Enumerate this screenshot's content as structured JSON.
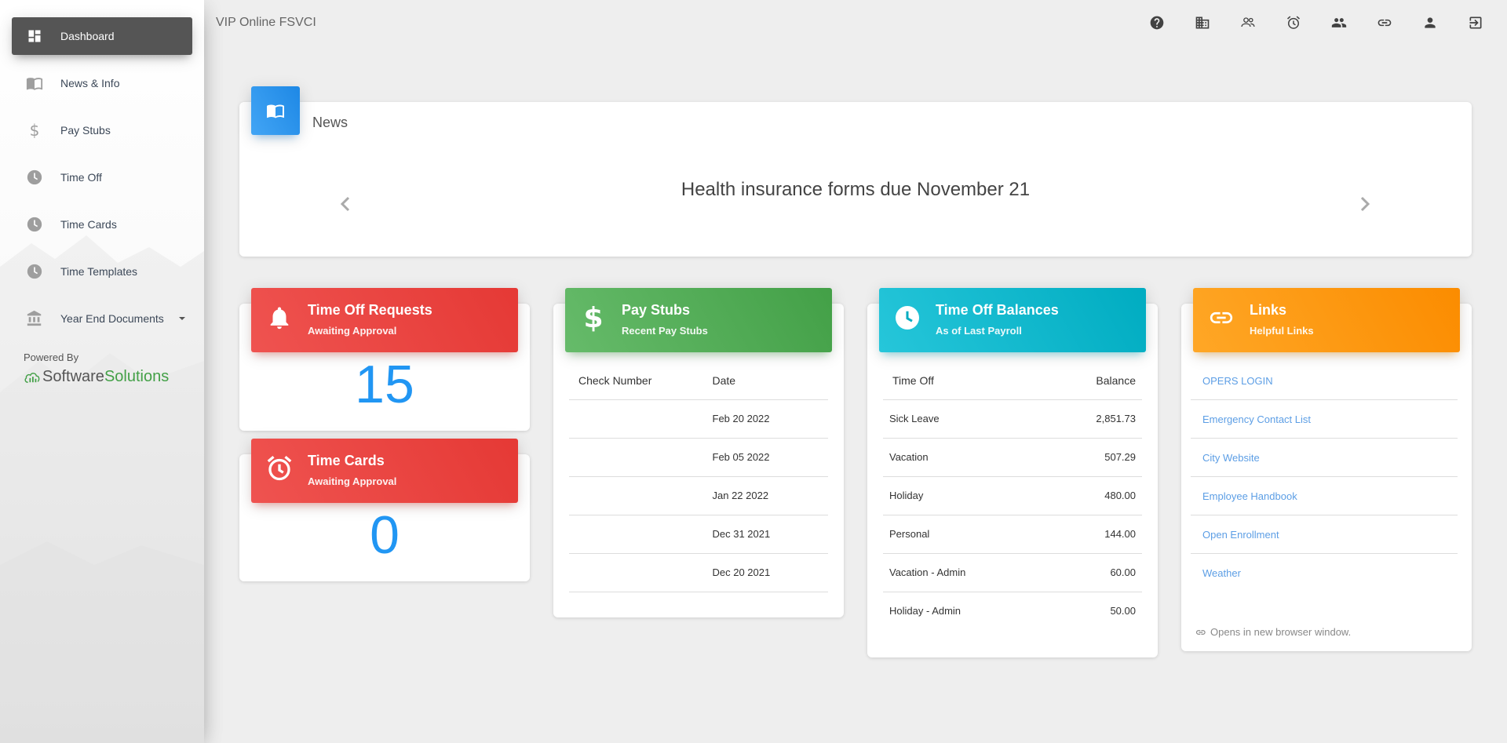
{
  "app": {
    "title": "VIP Online FSVCI"
  },
  "sidebar": {
    "items": [
      {
        "label": "Dashboard",
        "icon": "dashboard-icon",
        "active": true
      },
      {
        "label": "News & Info",
        "icon": "book-open-icon"
      },
      {
        "label": "Pay Stubs",
        "icon": "dollar-icon"
      },
      {
        "label": "Time Off",
        "icon": "clock-icon"
      },
      {
        "label": "Time Cards",
        "icon": "clock-icon"
      },
      {
        "label": "Time Templates",
        "icon": "clock-icon"
      },
      {
        "label": "Year End Documents",
        "icon": "bank-icon"
      }
    ],
    "powered_by": "Powered By",
    "brand": {
      "part1": "Software",
      "part2": "Solutions"
    }
  },
  "topbar": {
    "icons": [
      "help-icon",
      "building-icon",
      "group-outline-icon",
      "alarm-icon",
      "people-icon",
      "link-icon",
      "person-icon",
      "logout-icon"
    ]
  },
  "news": {
    "title": "News",
    "headline": "Health insurance forms due November 21"
  },
  "time_off_requests": {
    "title": "Time Off Requests",
    "subtitle": "Awaiting Approval",
    "count": "15"
  },
  "time_cards": {
    "title": "Time Cards",
    "subtitle": "Awaiting Approval",
    "count": "0"
  },
  "pay_stubs": {
    "title": "Pay Stubs",
    "subtitle": "Recent Pay Stubs",
    "columns": [
      "Check Number",
      "Date"
    ],
    "rows": [
      {
        "check": "",
        "date": "Feb 20 2022"
      },
      {
        "check": "",
        "date": "Feb 05 2022"
      },
      {
        "check": "",
        "date": "Jan 22 2022"
      },
      {
        "check": "",
        "date": "Dec 31 2021"
      },
      {
        "check": "",
        "date": "Dec 20 2021"
      }
    ]
  },
  "balances": {
    "title": "Time Off Balances",
    "subtitle": "As of Last Payroll",
    "columns": [
      "Time Off",
      "Balance"
    ],
    "rows": [
      {
        "name": "Sick Leave",
        "value": "2,851.73"
      },
      {
        "name": "Vacation",
        "value": "507.29"
      },
      {
        "name": "Holiday",
        "value": "480.00"
      },
      {
        "name": "Personal",
        "value": "144.00"
      },
      {
        "name": "Vacation - Admin",
        "value": "60.00"
      },
      {
        "name": "Holiday - Admin",
        "value": "50.00"
      }
    ]
  },
  "links": {
    "title": "Links",
    "subtitle": "Helpful Links",
    "items": [
      "OPERS LOGIN",
      "Emergency Contact List",
      "City Website",
      "Employee Handbook",
      "Open Enrollment",
      "Weather"
    ],
    "footer": "Opens in new browser window."
  },
  "colors": {
    "accent_blue": "#2196f3",
    "link_blue": "#5c9ee5",
    "red": "#e53935",
    "green": "#43a047",
    "cyan": "#00acc1",
    "orange": "#fb8c00",
    "active_nav": "#555555"
  }
}
